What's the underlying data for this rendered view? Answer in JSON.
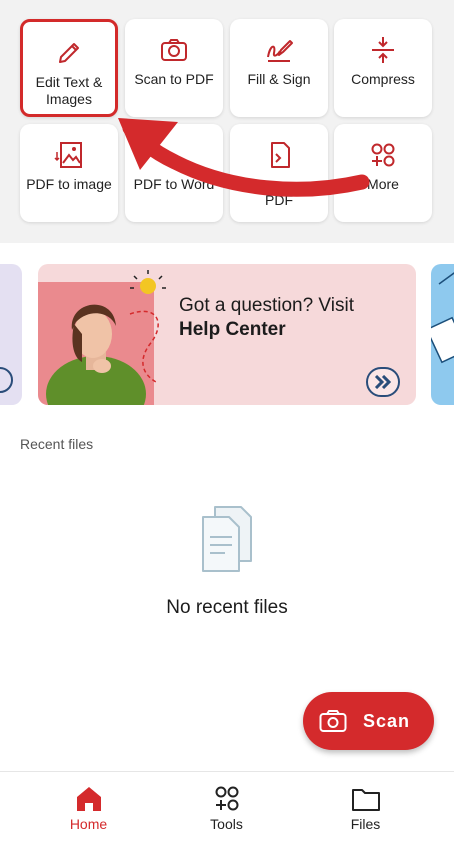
{
  "tools": [
    {
      "label": "Edit Text & Images",
      "icon": "pencil-icon"
    },
    {
      "label": "Scan to PDF",
      "icon": "camera-icon"
    },
    {
      "label": "Fill & Sign",
      "icon": "signature-icon"
    },
    {
      "label": "Compress",
      "icon": "compress-icon"
    },
    {
      "label": "PDF to image",
      "icon": "pdf-to-image-icon"
    },
    {
      "label": "PDF to Word",
      "icon": "pdf-to-word-icon"
    },
    {
      "label": "PDF",
      "icon": "document-icon"
    },
    {
      "label": "More",
      "icon": "more-icon"
    }
  ],
  "banner": {
    "line1": "Got a question? Visit",
    "line2": "Help Center"
  },
  "recent": {
    "title": "Recent files",
    "empty_text": "No recent files"
  },
  "scan_button": {
    "label": "Scan"
  },
  "nav": {
    "items": [
      {
        "label": "Home",
        "icon": "home-icon",
        "active": true
      },
      {
        "label": "Tools",
        "icon": "tools-icon",
        "active": false
      },
      {
        "label": "Files",
        "icon": "folder-icon",
        "active": false
      }
    ]
  },
  "colors": {
    "accent": "#d42a2c",
    "banner_bg": "#f6d9da",
    "icon_red": "#c0282c"
  }
}
